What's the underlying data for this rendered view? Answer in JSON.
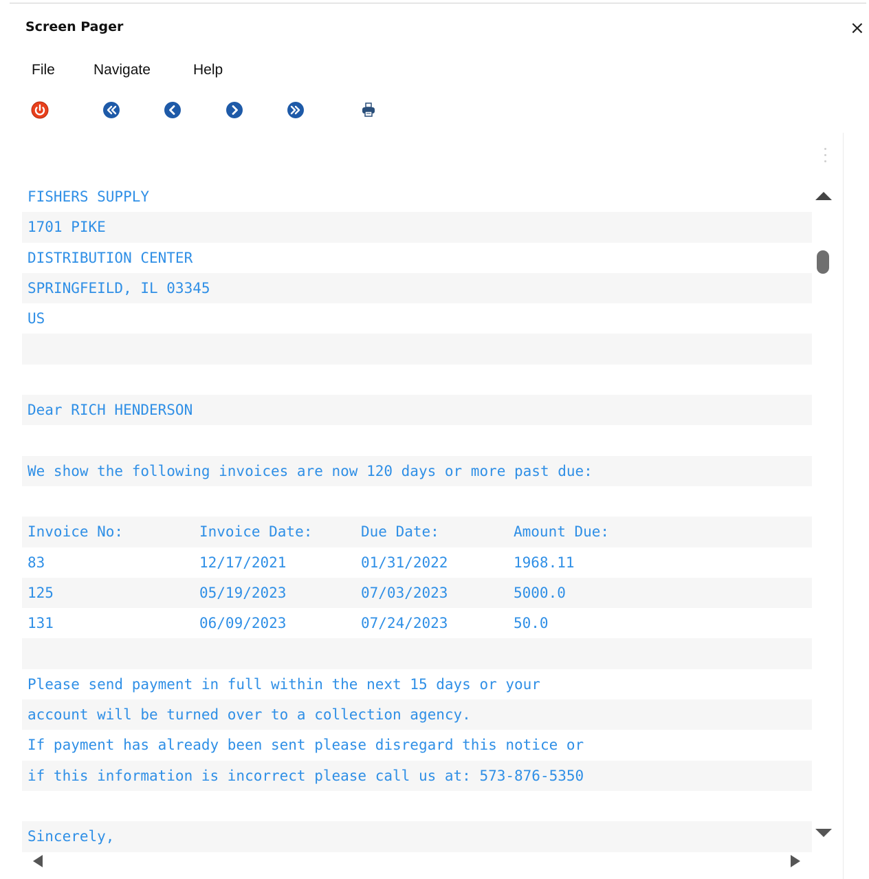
{
  "window": {
    "title": "Screen Pager",
    "close_glyph": "×"
  },
  "menu": {
    "items": [
      {
        "label": "File"
      },
      {
        "label": "Navigate"
      },
      {
        "label": "Help"
      }
    ]
  },
  "toolbar": {
    "buttons": [
      {
        "icon": "power-icon",
        "color": "#e8401c"
      },
      {
        "icon": "first-page-icon",
        "color": "#1e5aa8"
      },
      {
        "icon": "previous-page-icon",
        "color": "#1e5aa8"
      },
      {
        "icon": "next-page-icon",
        "color": "#1e5aa8"
      },
      {
        "icon": "last-page-icon",
        "color": "#1e5aa8"
      },
      {
        "icon": "print-icon",
        "color": "#2a4f7a"
      }
    ]
  },
  "document": {
    "text_color": "#2f8fe6",
    "address": [
      "FISHERS SUPPLY",
      "1701 PIKE",
      "DISTRIBUTION CENTER",
      "SPRINGFEILD, IL 03345",
      "US"
    ],
    "greeting": "Dear RICH HENDERSON",
    "intro": "We show the following invoices are now 120 days or more past due:",
    "invoice_headers": [
      "Invoice No:",
      "Invoice Date:",
      "Due Date:",
      "Amount Due:"
    ],
    "invoices": [
      [
        "83",
        "12/17/2021",
        "01/31/2022",
        "1968.11"
      ],
      [
        "125",
        "05/19/2023",
        "07/03/2023",
        "5000.0"
      ],
      [
        "131",
        "06/09/2023",
        "07/24/2023",
        "50.0"
      ]
    ],
    "closing_paragraph": [
      "Please send payment in full within the next 15 days or your",
      "account will be turned over to a collection agency.",
      "If payment has already been sent please disregard this notice or",
      "if this information is incorrect please call us at: 573-876-5350"
    ],
    "signoff": "Sincerely,"
  }
}
